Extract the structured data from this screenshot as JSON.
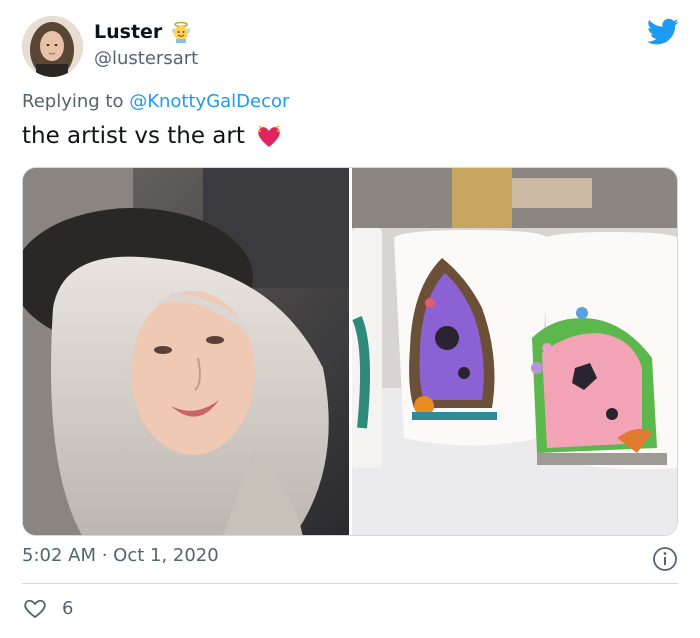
{
  "author": {
    "display_name": "Luster",
    "handle": "@lustersart"
  },
  "reply": {
    "prefix": "Replying to ",
    "mention": "@KnottyGalDecor"
  },
  "tweet": {
    "text": "the artist vs the art"
  },
  "meta": {
    "timestamp": "5:02 AM · Oct 1, 2020"
  },
  "engagement": {
    "like_count": "6"
  },
  "colors": {
    "twitter_blue": "#1d9bf0",
    "secondary_text": "#536471",
    "heart_red": "#e0245e"
  },
  "icons": {
    "brand": "twitter-bird-icon",
    "badge": "angel-emoji-icon",
    "emoji": "heart-emoji-icon",
    "info": "info-icon",
    "like": "heart-outline-icon"
  }
}
